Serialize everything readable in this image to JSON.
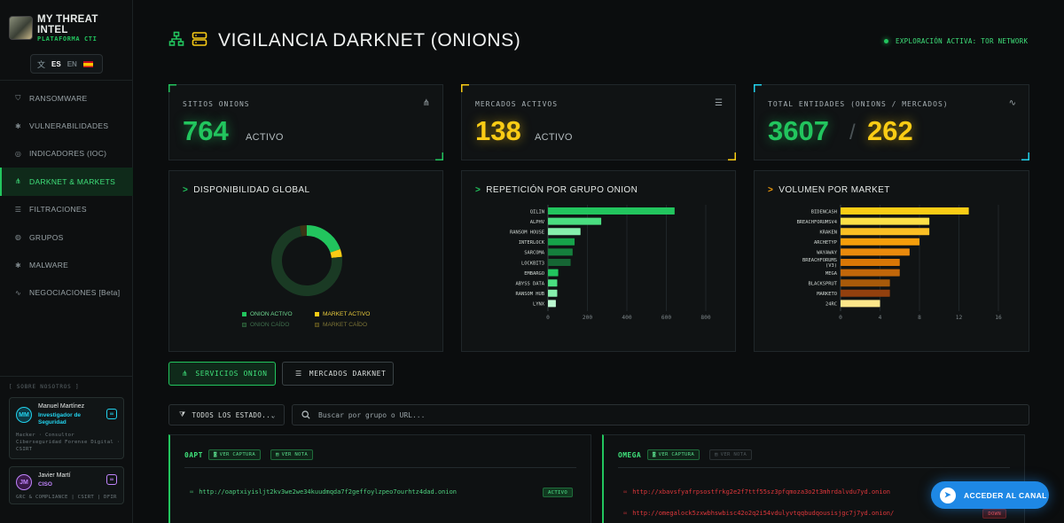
{
  "brand": {
    "title": "MY THREAT INTEL",
    "subtitle": "PLATAFORMA CTI"
  },
  "language": {
    "icon": "translate-icon",
    "active": "ES",
    "other": "EN",
    "flag": "spain-flag-icon"
  },
  "nav": [
    {
      "label": "RANSOMWARE",
      "icon": "shield-icon",
      "active": false
    },
    {
      "label": "VULNERABILIDADES",
      "icon": "bug-icon",
      "active": false
    },
    {
      "label": "INDICADORES (IOC)",
      "icon": "fingerprint-icon",
      "active": false
    },
    {
      "label": "DARKNET & MARKETS",
      "icon": "network-icon",
      "active": true
    },
    {
      "label": "FILTRACIONES",
      "icon": "database-icon",
      "active": false
    },
    {
      "label": "GRUPOS",
      "icon": "globe-icon",
      "active": false
    },
    {
      "label": "MALWARE",
      "icon": "bug-icon",
      "active": false
    },
    {
      "label": "NEGOCIACIONES [Beta]",
      "icon": "activity-icon",
      "active": false
    }
  ],
  "about": {
    "label": "[ SOBRE NOSOTROS ]",
    "members": [
      {
        "initials": "MM",
        "name": "Manuel Martínez",
        "role": "Investigador de Seguridad",
        "description": [
          "Hacker · Consultor",
          "Ciberseguridad Forense Digital ·",
          "CSIRT"
        ],
        "accent": "#22d3ee"
      },
      {
        "initials": "JM",
        "name": "Javier Martí",
        "role": "CISO",
        "description": [
          "GRC & COMPLIANCE | CSIRT | DFIR"
        ],
        "accent": "#c084fc"
      }
    ]
  },
  "header": {
    "title": "VIGILANCIA DARKNET (ONIONS)",
    "status": "EXPLORACIÓN ACTIVA: TOR NETWORK"
  },
  "stats": {
    "onion_sites": {
      "label": "SITIOS ONIONS",
      "value": "764",
      "unit": "ACTIVO",
      "icon": "network-icon"
    },
    "markets": {
      "label": "MERCADOS ACTIVOS",
      "value": "138",
      "unit": "ACTIVO",
      "icon": "server-icon"
    },
    "total": {
      "label": "TOTAL ENTIDADES (ONIONS / MERCADOS)",
      "onions": "3607",
      "separator": "/",
      "markets": "262",
      "icon": "activity-icon"
    }
  },
  "colors": {
    "green": "#22c55e",
    "yellow": "#facc15",
    "green_dark": "#1a3a24",
    "yellow_dark": "#3a3414",
    "bg": "#0b0d0e"
  },
  "chart_data": [
    {
      "type": "pie",
      "title": "DISPONIBILIDAD GLOBAL",
      "series": [
        {
          "name": "ONION ACTIVO",
          "value": 764,
          "color": "#22c55e"
        },
        {
          "name": "MARKET ACTIVO",
          "value": 138,
          "color": "#facc15"
        },
        {
          "name": "ONION CAÍDO",
          "value": 2843,
          "color": "#1a3a24"
        },
        {
          "name": "MARKET CAÍDO",
          "value": 124,
          "color": "#3a3414"
        }
      ],
      "legend": "bottom"
    },
    {
      "type": "bar",
      "orientation": "horizontal",
      "title": "REPETICIÓN POR GRUPO ONION",
      "categories": [
        "QILIN",
        "ALPHV",
        "RANSOM HOUSE",
        "INTERLOCK",
        "SARCOMA",
        "LOCKBIT3",
        "EMBARGO",
        "ABYSS DATA",
        "RANSOM HUB",
        "LYNX"
      ],
      "values": [
        642,
        270,
        165,
        135,
        125,
        115,
        52,
        47,
        47,
        40
      ],
      "xlim": [
        0,
        800
      ],
      "xticks": [
        "0",
        "200",
        "400",
        "600",
        "800"
      ],
      "grid": true
    },
    {
      "type": "bar",
      "orientation": "horizontal",
      "title": "VOLUMEN POR MARKET",
      "categories": [
        "BIDENCASH",
        "BREACHFORUMSV4",
        "KRAKEN",
        "ARCHETYP",
        "WAYAWAY",
        "BREACHFORUMS (V3)",
        "MEGA",
        "BLACKSPRUT",
        "MARKETO",
        "24RC"
      ],
      "values": [
        13,
        9,
        9,
        8,
        7,
        6,
        6,
        5,
        5,
        4
      ],
      "xlim": [
        0,
        16
      ],
      "xticks": [
        "0",
        "4",
        "8",
        "12",
        "16"
      ],
      "grid": true
    }
  ],
  "tabs": [
    {
      "label": "SERVICIOS ONION",
      "icon": "network-icon",
      "active": true
    },
    {
      "label": "MERCADOS DARKNET",
      "icon": "server-icon",
      "active": false
    }
  ],
  "filters": {
    "status_select": "TODOS LOS ESTADO...",
    "search_placeholder": "Buscar por grupo o URL..."
  },
  "entities": [
    {
      "name": "0APT",
      "capture_label": "VER CAPTURA",
      "note_label": "VER NOTA",
      "urls": [
        {
          "url": "http://oaptxiyisljt2kv3we2we34kuudmqda7f2geffoylzpeo7ourhtz4dad.onion",
          "status": "ACTIVO"
        }
      ]
    },
    {
      "name": "OMEGA",
      "capture_label": "VER CAPTURA",
      "note_label": "VER NOTA",
      "urls": [
        {
          "url": "http://xbavsfyafrpsostfrkg2e2f7ttf55sz3pfqmoza3o2t3mhrdalvdu7yd.onion",
          "status": ""
        },
        {
          "url": "http://omegalock5zxwbhswbisc42o2q2i54vdulyvtqqbudqousisjgc7j7yd.onion/",
          "status": "DOWN"
        }
      ]
    }
  ],
  "telegram": {
    "label": "ACCEDER AL CANAL",
    "icon": "telegram-icon"
  }
}
